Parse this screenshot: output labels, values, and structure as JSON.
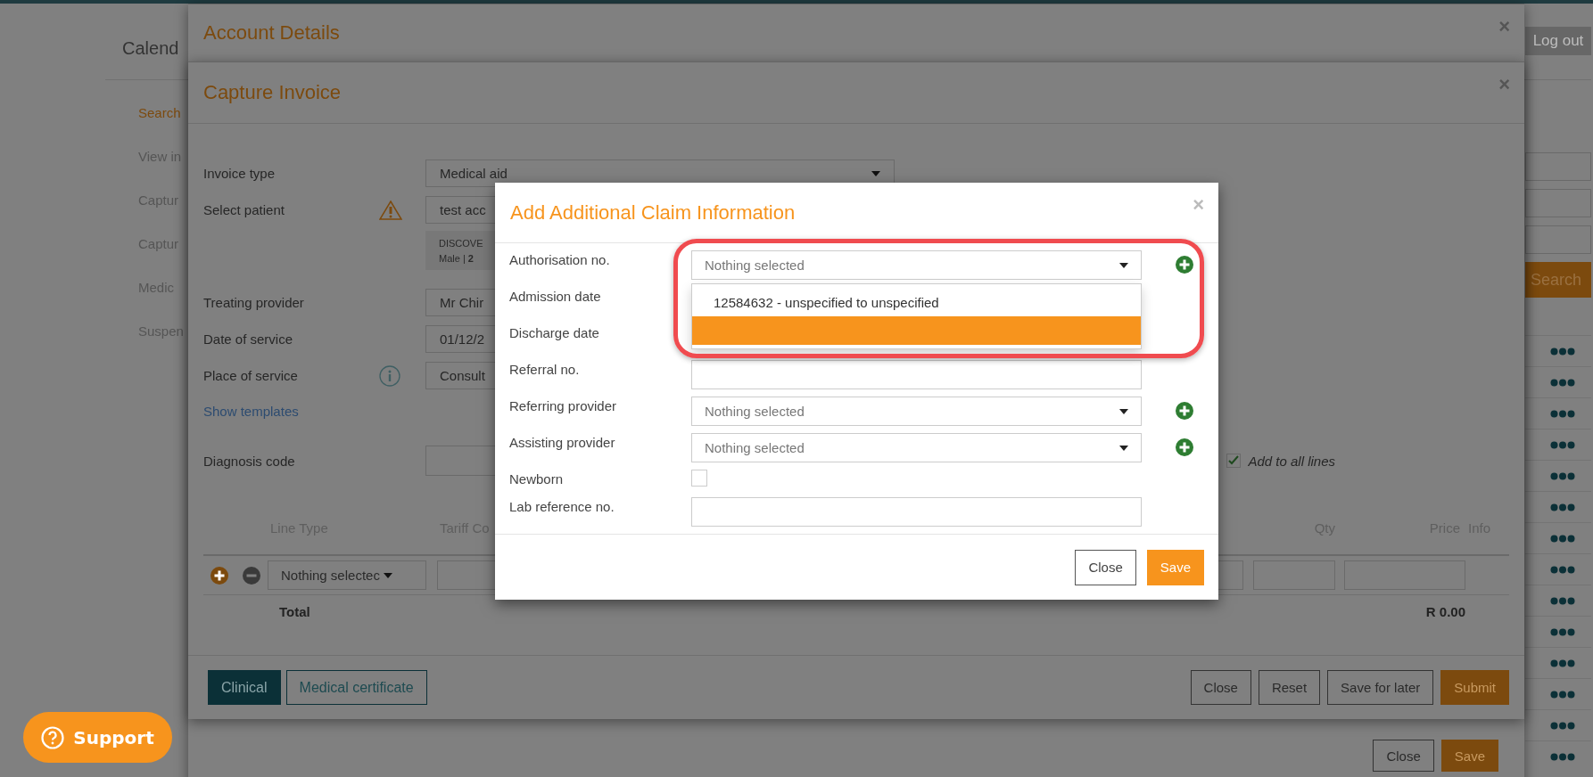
{
  "page": {
    "title": "Calend",
    "logout": "Log out",
    "nav": [
      {
        "label": "Search",
        "selected": true
      },
      {
        "label": "View in",
        "selected": false
      },
      {
        "label": "Captur",
        "selected": false
      },
      {
        "label": "Captur",
        "selected": false
      },
      {
        "label": "Medic",
        "selected": false
      },
      {
        "label": "Suspen",
        "selected": false
      }
    ],
    "search_button": "Search"
  },
  "account_dialog": {
    "title": "Account Details",
    "close": "×",
    "buttons": [
      {
        "label": "Close",
        "kind": "secondary"
      },
      {
        "label": "Save",
        "kind": "primary"
      }
    ]
  },
  "invoice_dialog": {
    "title": "Capture Invoice",
    "close": "×",
    "fields": [
      {
        "label": "Invoice type",
        "kind": "select",
        "value": "Medical aid"
      },
      {
        "label": "Select patient",
        "kind": "input",
        "hint": {
          "kind": "warning"
        },
        "value": "test acc",
        "details": [
          "DISCOVE",
          "Male | **2**"
        ]
      },
      {
        "label": "Treating provider",
        "kind": "input",
        "value": "Mr Chir"
      },
      {
        "label": "Date of service",
        "kind": "input",
        "value": "01/12/2"
      },
      {
        "label": "Place of service",
        "kind": "input",
        "hint": {
          "kind": "info"
        },
        "value": "Consult"
      }
    ],
    "templates_link": "Show templates",
    "diagnosis": {
      "label": "Diagnosis code",
      "add_to_all": {
        "label": "Add to all lines",
        "checked": true
      }
    },
    "columns": [
      "Line Type",
      "Tariff Co",
      "Qty",
      "Price",
      "Info"
    ],
    "line": {
      "line_type": "Nothing selectec"
    },
    "total": {
      "label": "Total",
      "amount": "R 0.00"
    },
    "tabs": [
      {
        "label": "Clinical",
        "selected": true
      },
      {
        "label": "Medical certificate",
        "selected": false
      }
    ],
    "buttons": [
      {
        "label": "Close",
        "kind": "secondary"
      },
      {
        "label": "Reset",
        "kind": "secondary"
      },
      {
        "label": "Save for later",
        "kind": "secondary"
      },
      {
        "label": "Submit",
        "kind": "primary"
      }
    ]
  },
  "claim_dialog": {
    "title": "Add Additional Claim Information",
    "close": "×",
    "fields": [
      {
        "label": "Authorisation no.",
        "kind": "select",
        "placeholder": "Nothing selected",
        "addable": true,
        "highlighted": true,
        "options": [
          {
            "label": "12584632 - unspecified to unspecified",
            "selected": false
          },
          {
            "selected": true
          }
        ]
      },
      {
        "label": "Admission date",
        "kind": "covered"
      },
      {
        "label": "Discharge date",
        "kind": "covered"
      },
      {
        "label": "Referral no.",
        "kind": "input"
      },
      {
        "label": "Referring provider",
        "kind": "select",
        "placeholder": "Nothing selected",
        "addable": true
      },
      {
        "label": "Assisting provider",
        "kind": "select",
        "placeholder": "Nothing selected",
        "addable": true
      },
      {
        "label": "Newborn",
        "kind": "checkbox",
        "checked": false
      },
      {
        "label": "Lab reference no.",
        "kind": "input"
      }
    ],
    "buttons": [
      {
        "label": "Close",
        "kind": "secondary"
      },
      {
        "label": "Save",
        "kind": "primary"
      }
    ]
  },
  "support": {
    "label": "Support"
  }
}
